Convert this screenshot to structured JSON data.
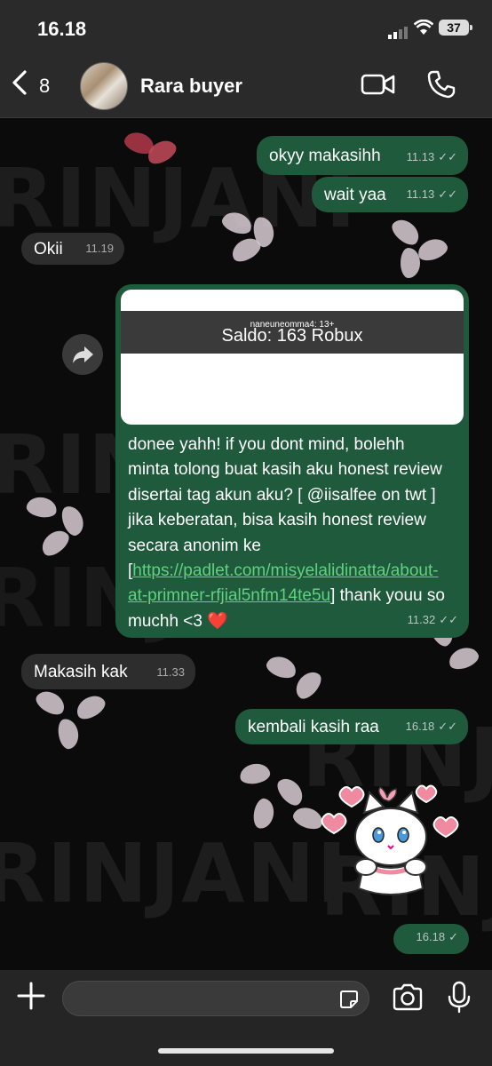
{
  "status_bar": {
    "time": "16.18",
    "battery": "37"
  },
  "header": {
    "back_count": "8",
    "contact_name": "Rara buyer"
  },
  "wallpaper": {
    "watermark": "RINJANI"
  },
  "messages": [
    {
      "type": "out",
      "text": "okyy makasihh",
      "time": "11.13",
      "ticks": "✓✓"
    },
    {
      "type": "out",
      "text": "wait yaa",
      "time": "11.13",
      "ticks": "✓✓"
    },
    {
      "type": "in",
      "text": "Okii",
      "time": "11.19"
    },
    {
      "type": "out-image",
      "preview_user": "naneuneomma4: 13+",
      "preview_saldo": "Saldo: 163 Robux",
      "text_1": "donee yahh! if you dont mind, bolehh minta tolong buat kasih aku honest review disertai tag akun aku? [ @iisalfee on twt ] jika keberatan, bisa kasih honest review secara anonim ke [",
      "link": "https://padlet.com/misyelalidinatta/about-at-primner-rfjial5nfm14te5u",
      "text_2": "] thank youu so muchh <3 ❤️",
      "time": "11.32",
      "ticks": "✓✓"
    },
    {
      "type": "in",
      "text": "Makasih kak",
      "time": "11.33"
    },
    {
      "type": "out",
      "text": "kembali kasih raa",
      "time": "16.18",
      "ticks": "✓✓"
    },
    {
      "type": "sticker-out",
      "sticker": "white-cat-hearts",
      "time": "16.18",
      "ticks": "✓"
    }
  ],
  "icons": [
    "back-chevron",
    "video-call",
    "phone",
    "forward",
    "plus",
    "sticker",
    "camera",
    "microphone"
  ],
  "colors": {
    "outgoing_bubble": "#1e5a3b",
    "incoming_bubble": "#2d2d2d",
    "link": "#5fd27f"
  }
}
